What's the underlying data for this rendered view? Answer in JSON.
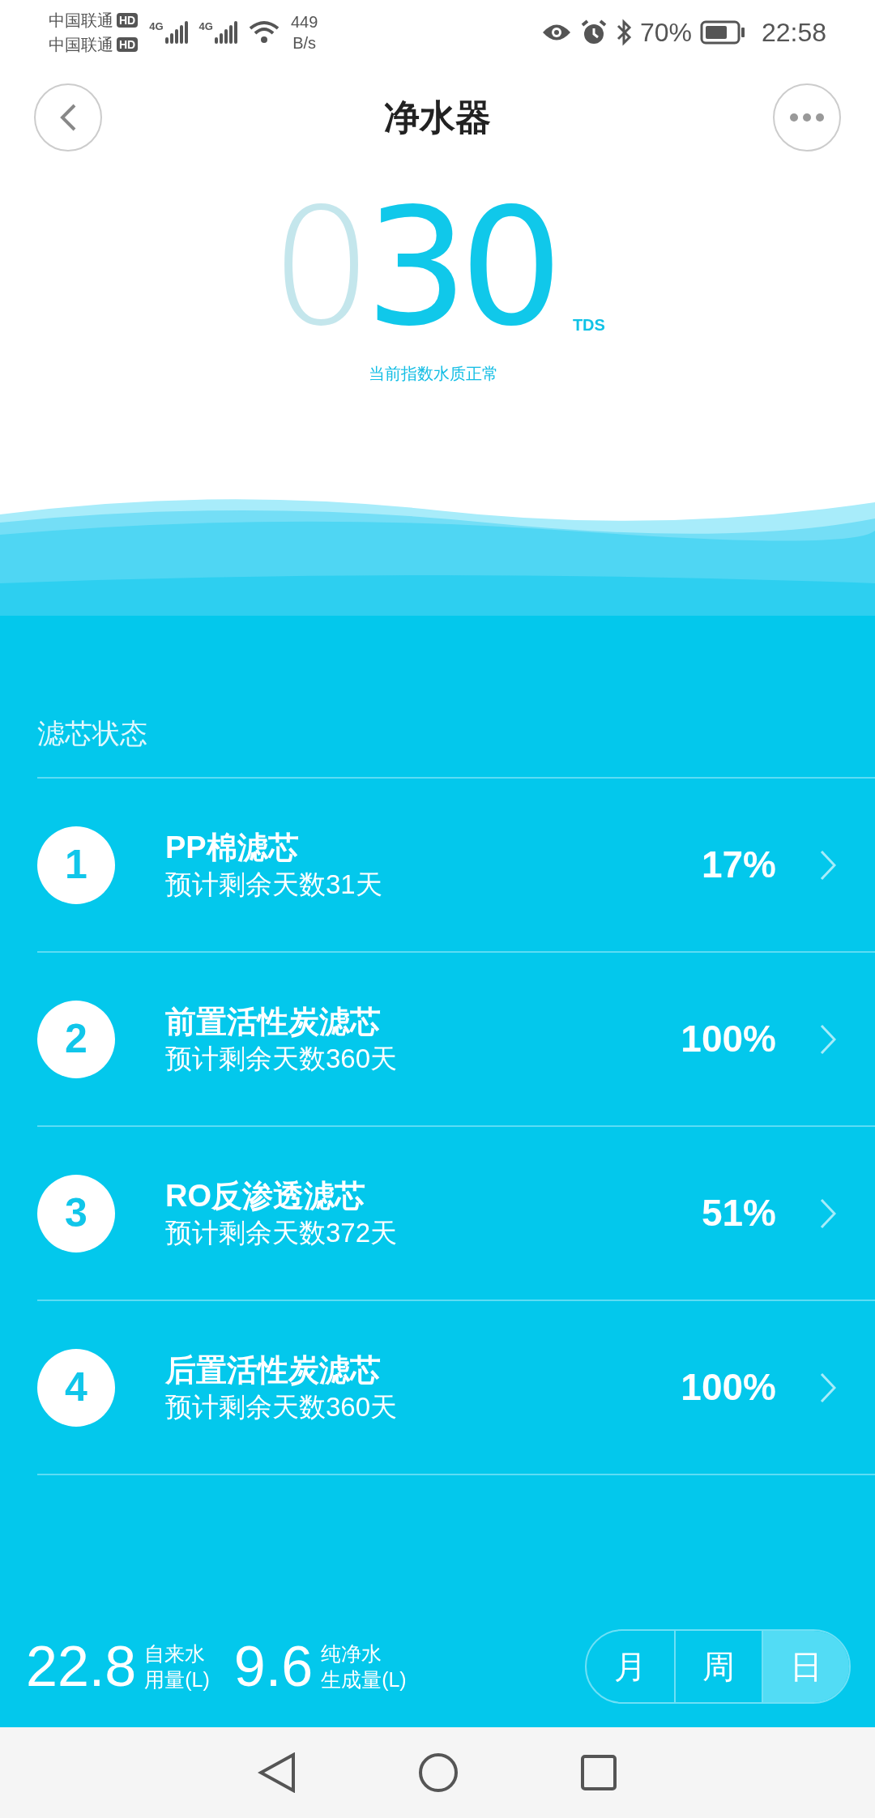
{
  "status_bar": {
    "carriers": [
      "中国联通",
      "中国联通"
    ],
    "hd_badges": [
      "HD",
      "HD"
    ],
    "network": [
      "4G",
      "4G"
    ],
    "speed": [
      "449",
      "B/s"
    ],
    "battery": "70%",
    "time": "22:58"
  },
  "header": {
    "title": "净水器"
  },
  "tds": {
    "leading": "0",
    "value": "30",
    "unit": "TDS",
    "caption": "当前指数水质正常"
  },
  "filters": {
    "title": "滤芯状态",
    "items": [
      {
        "number": "1",
        "name": "PP棉滤芯",
        "remaining": "预计剩余天数31天",
        "percent": "17%"
      },
      {
        "number": "2",
        "name": "前置活性炭滤芯",
        "remaining": "预计剩余天数360天",
        "percent": "100%"
      },
      {
        "number": "3",
        "name": "RO反渗透滤芯",
        "remaining": "预计剩余天数372天",
        "percent": "51%"
      },
      {
        "number": "4",
        "name": "后置活性炭滤芯",
        "remaining": "预计剩余天数360天",
        "percent": "100%"
      }
    ]
  },
  "stats": [
    {
      "value": "22.8",
      "label": [
        "自来水",
        "用量(L)"
      ]
    },
    {
      "value": "9.6",
      "label": [
        "纯净水",
        "生成量(L)"
      ]
    }
  ],
  "period_tabs": [
    {
      "label": "月",
      "selected": false
    },
    {
      "label": "周",
      "selected": false
    },
    {
      "label": "日",
      "selected": true
    }
  ]
}
